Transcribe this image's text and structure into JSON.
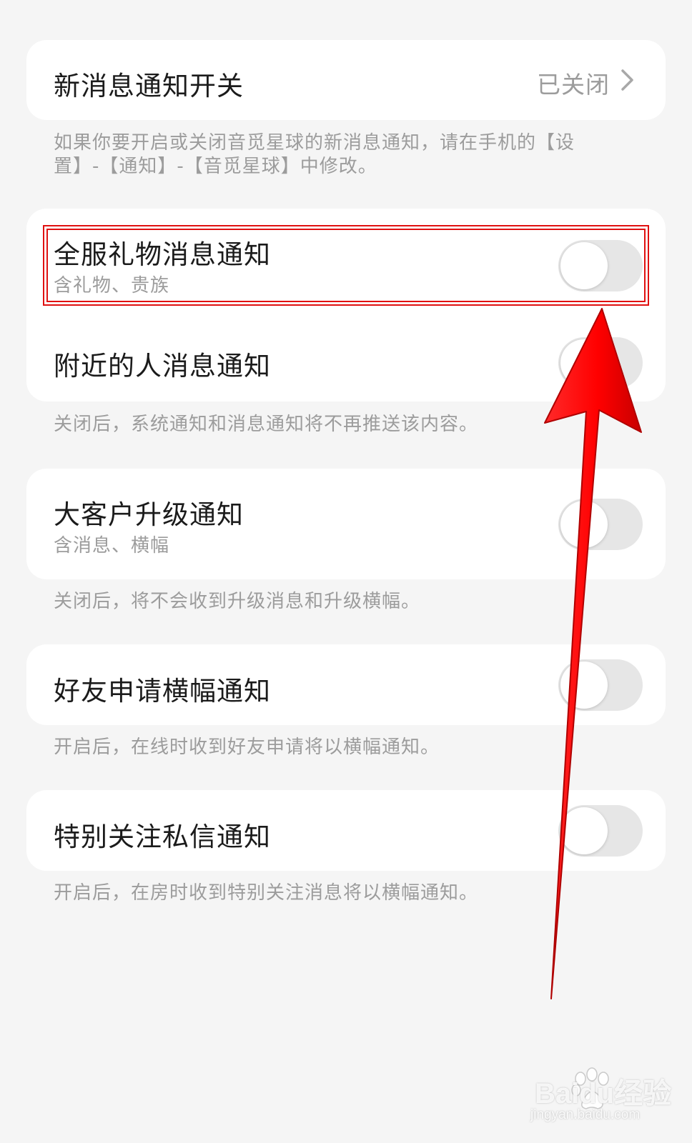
{
  "new_message_switch": {
    "title": "新消息通知开关",
    "status": "已关闭",
    "note": "如果你要开启或关闭音觅星球的新消息通知，请在手机的【设置】-【通知】-【音觅星球】中修改。"
  },
  "group1": {
    "items": [
      {
        "title": "全服礼物消息通知",
        "subtitle": "含礼物、贵族",
        "enabled": false
      },
      {
        "title": "附近的人消息通知",
        "enabled": false
      }
    ],
    "note": "关闭后，系统通知和消息通知将不再推送该内容。"
  },
  "group2": {
    "title": "大客户升级通知",
    "subtitle": "含消息、横幅",
    "enabled": false,
    "note": "关闭后，将不会收到升级消息和升级横幅。"
  },
  "group3": {
    "title": "好友申请横幅通知",
    "enabled": false,
    "note": "开启后，在线时收到好友申请将以横幅通知。"
  },
  "group4": {
    "title": "特别关注私信通知",
    "enabled": false,
    "note": "开启后，在房时收到特别关注消息将以横幅通知。"
  },
  "annotation": {
    "highlight_color": "#e01010",
    "arrow_color": "#ff0000"
  },
  "watermark": {
    "logo_text": "Baidu经验",
    "url": "jingyan.baidu.com"
  }
}
